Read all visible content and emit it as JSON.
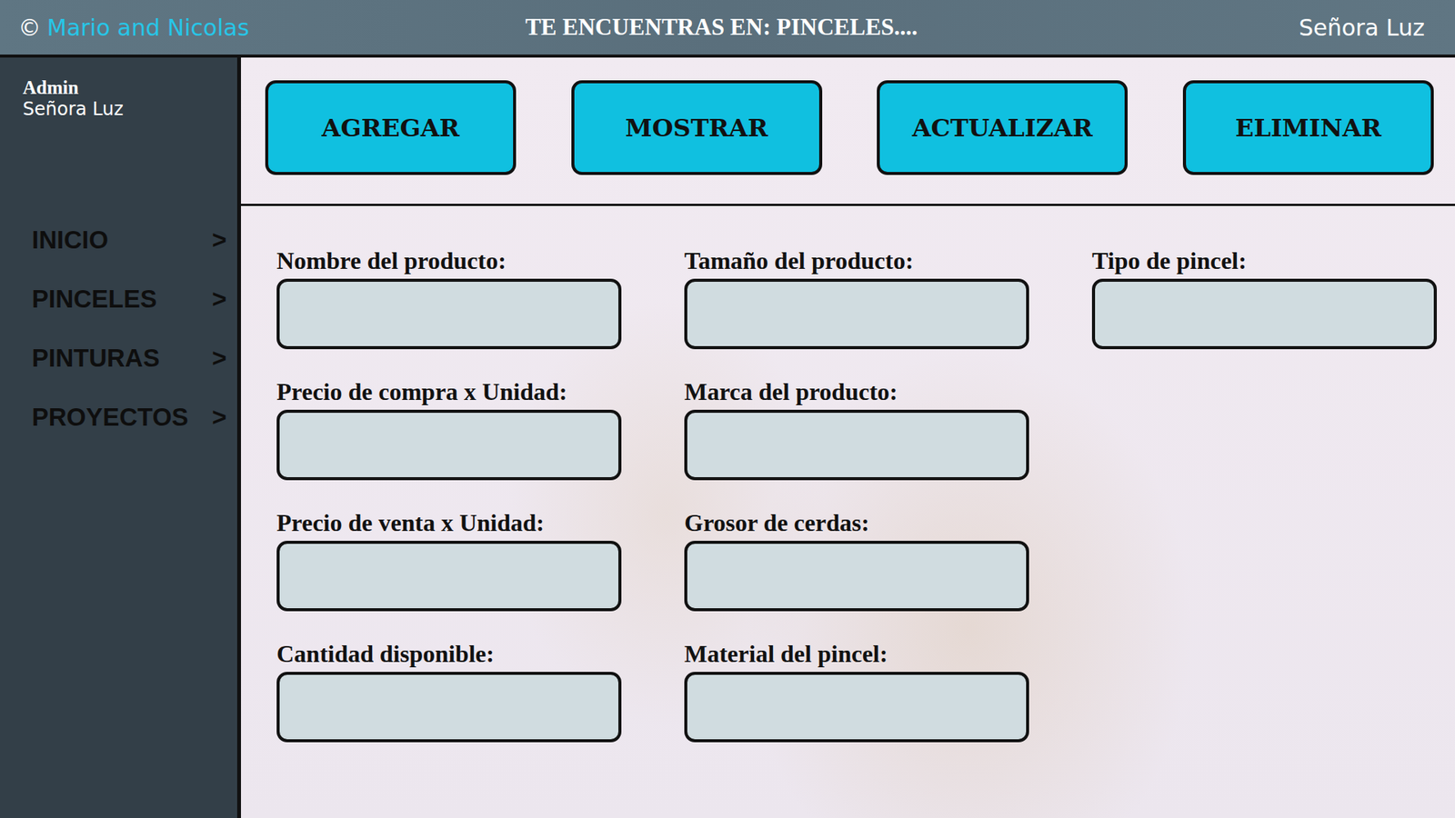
{
  "top_bar": {
    "copyright": "©",
    "brand": "Mario and Nicolas",
    "breadcrumb": "TE ENCUENTRAS EN: PINCELES....",
    "user": "Señora Luz"
  },
  "sidebar": {
    "role": "Admin",
    "name": "Señora Luz",
    "items": [
      {
        "label": "INICIO",
        "arrow": ">"
      },
      {
        "label": "PINCELES",
        "arrow": ">"
      },
      {
        "label": "PINTURAS",
        "arrow": ">"
      },
      {
        "label": "PROYECTOS",
        "arrow": ">"
      }
    ]
  },
  "toolbar": {
    "buttons": [
      "AGREGAR",
      "MOSTRAR",
      "ACTUALIZAR",
      "ELIMINAR"
    ]
  },
  "form": {
    "columns": [
      [
        {
          "label": "Nombre del producto:",
          "value": ""
        },
        {
          "label": "Precio de compra x Unidad:",
          "value": ""
        },
        {
          "label": "Precio de venta x Unidad:",
          "value": ""
        },
        {
          "label": "Cantidad disponible:",
          "value": ""
        }
      ],
      [
        {
          "label": "Tamaño del producto:",
          "value": ""
        },
        {
          "label": "Marca del producto:",
          "value": ""
        },
        {
          "label": "Grosor de cerdas:",
          "value": ""
        },
        {
          "label": "Material del pincel:",
          "value": ""
        }
      ],
      [
        {
          "label": "Tipo de pincel:",
          "value": ""
        }
      ]
    ]
  }
}
